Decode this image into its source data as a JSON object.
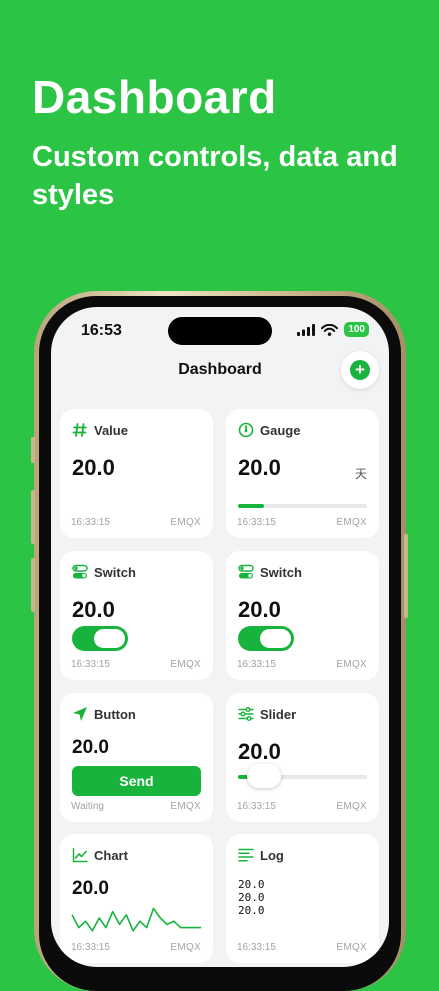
{
  "promo": {
    "title": "Dashboard",
    "subtitle": "Custom controls, data and styles"
  },
  "status_bar": {
    "time": "16:53",
    "battery": "100"
  },
  "nav": {
    "title": "Dashboard",
    "add_icon": "plus-icon"
  },
  "colors": {
    "background": "#2BC444",
    "accent": "#17B33C",
    "card": "#FFFFFF",
    "screen": "#F2F3F5"
  },
  "cards": {
    "value": {
      "title": "Value",
      "icon": "hash-icon",
      "value": "20.0",
      "time": "16:33:15",
      "source": "EMQX"
    },
    "gauge": {
      "title": "Gauge",
      "icon": "gauge-icon",
      "value": "20.0",
      "unit": "天",
      "level": 0.2,
      "time": "16:33:15",
      "source": "EMQX"
    },
    "switch1": {
      "title": "Switch",
      "icon": "toggle-icon",
      "value": "20.0",
      "state": "on",
      "time": "16:33:15",
      "source": "EMQX"
    },
    "switch2": {
      "title": "Switch",
      "icon": "toggle-icon",
      "value": "20.0",
      "state": "on",
      "time": "16:33:15",
      "source": "EMQX"
    },
    "button": {
      "title": "Button",
      "icon": "send-icon",
      "value": "20.0",
      "button_label": "Send",
      "status": "Waiting",
      "source": "EMQX"
    },
    "slider": {
      "title": "Slider",
      "icon": "sliders-icon",
      "value": "20.0",
      "level": 0.2,
      "time": "16:33:15",
      "source": "EMQX"
    },
    "chart": {
      "title": "Chart",
      "icon": "line-chart-icon",
      "value": "20.0",
      "time": "16:33:15",
      "source": "EMQX"
    },
    "log": {
      "title": "Log",
      "icon": "list-icon",
      "lines": [
        "20.0",
        "20.0",
        "20.0"
      ],
      "time": "16:33:15",
      "source": "EMQX"
    }
  },
  "chart_data": {
    "type": "line",
    "x": [
      0,
      1,
      2,
      3,
      4,
      5,
      6,
      7,
      8,
      9,
      10,
      11,
      12,
      13,
      14,
      15,
      16,
      17,
      18,
      19
    ],
    "series": [
      {
        "values": [
          6,
          2,
          4,
          1,
          5,
          2,
          7,
          3,
          6,
          1,
          4,
          2,
          8,
          5,
          3,
          4,
          2,
          2,
          2,
          2
        ]
      }
    ],
    "ylim": [
      0,
      10
    ],
    "grid": false
  }
}
